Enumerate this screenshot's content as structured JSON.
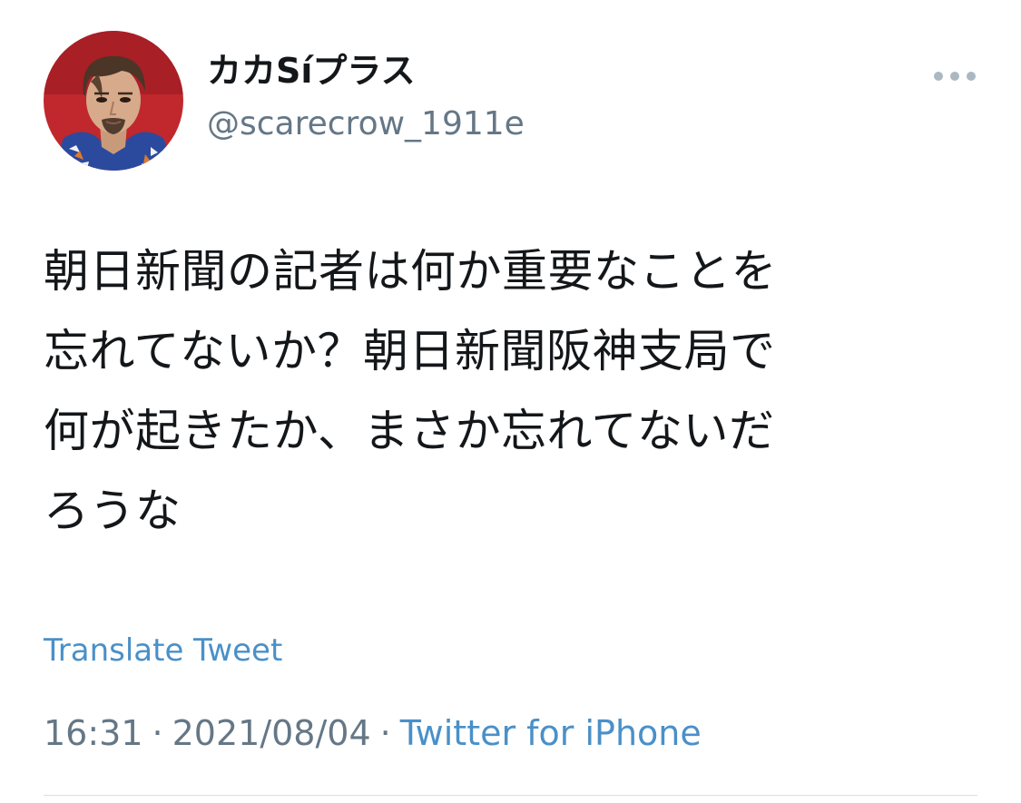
{
  "tweet": {
    "author": {
      "display_name": "カカSíプラス",
      "handle": "@scarecrow_1911e"
    },
    "text": "朝日新聞の記者は何か重要なことを\n忘れてないか？朝日新聞阪神支局で\n何が起きたか、まさか忘れてないだ\nろうな",
    "translate_label": "Translate Tweet",
    "time": "16:31",
    "separator": "·",
    "date": "2021/08/04",
    "source": "Twitter for iPhone"
  },
  "icons": {
    "more": "more-horizontal-icon",
    "avatar": "profile-avatar"
  },
  "colors": {
    "link": "#4a90c8",
    "secondary_text": "#657786",
    "primary_text": "#14171a",
    "avatar_background": "#c0282d"
  }
}
